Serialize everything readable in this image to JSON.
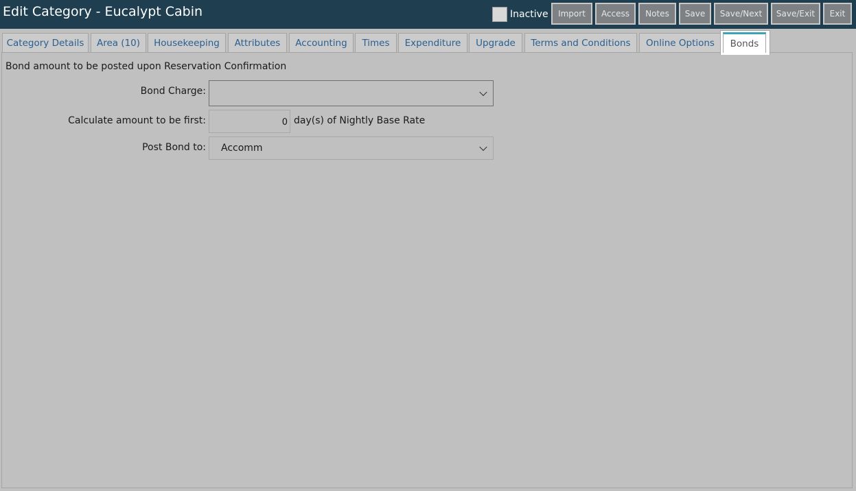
{
  "window": {
    "title": "Edit Category - Eucalypt Cabin"
  },
  "toolbar": {
    "inactive_label": "Inactive",
    "buttons": {
      "import": "Import",
      "access": "Access",
      "notes": "Notes",
      "save": "Save",
      "save_next": "Save/Next",
      "save_exit": "Save/Exit",
      "exit": "Exit"
    }
  },
  "tabs": [
    {
      "label": "Category Details"
    },
    {
      "label": "Area (10)"
    },
    {
      "label": "Housekeeping"
    },
    {
      "label": "Attributes"
    },
    {
      "label": "Accounting"
    },
    {
      "label": "Times"
    },
    {
      "label": "Expenditure"
    },
    {
      "label": "Upgrade"
    },
    {
      "label": "Terms and Conditions"
    },
    {
      "label": "Online Options"
    },
    {
      "label": "Bonds",
      "active": true
    }
  ],
  "bonds": {
    "heading": "Bond amount to be posted upon Reservation Confirmation",
    "bond_charge_label": "Bond Charge:",
    "bond_charge_value": "",
    "calc_label": "Calculate amount to be first:",
    "calc_value": "0",
    "calc_suffix": "day(s) of Nightly Base Rate",
    "post_to_label": "Post Bond to:",
    "post_to_value": "Accomm"
  },
  "colors": {
    "header_bg": "#1f3f50",
    "page_bg": "#c0c0c0",
    "tab_text": "#2a5f91",
    "active_tab_accent": "#3aa6b5"
  }
}
